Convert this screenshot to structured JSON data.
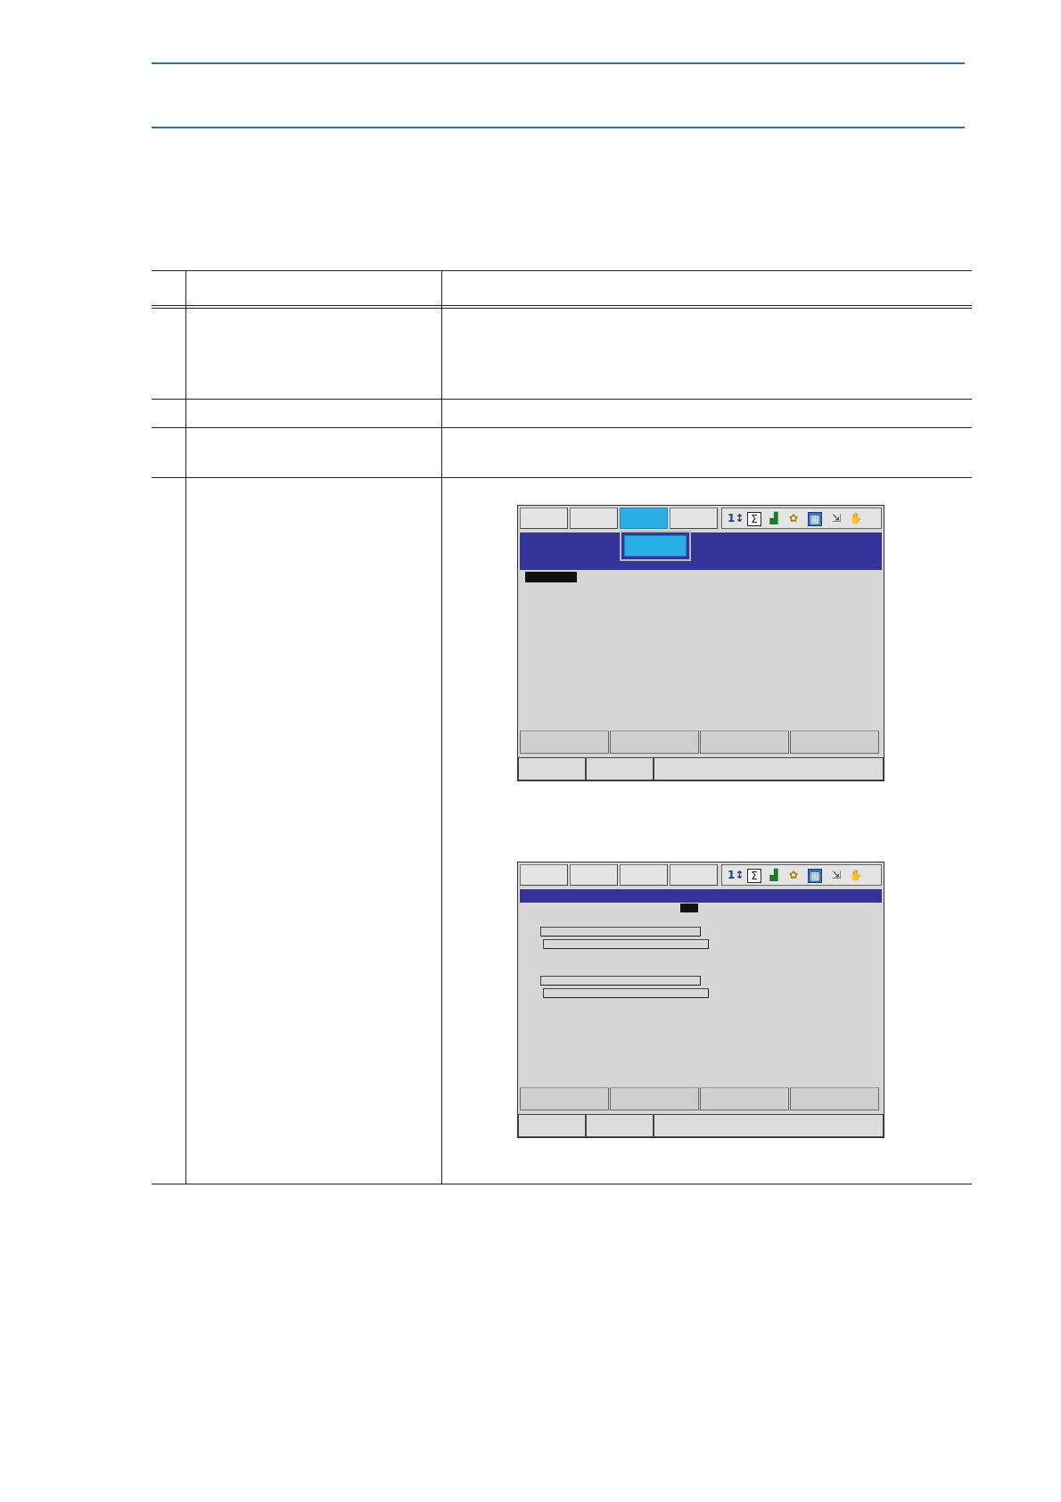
{
  "page": {
    "header_text": "",
    "intro_text": ""
  },
  "table": {
    "headers": {
      "no": "",
      "operation": "",
      "explanation": ""
    },
    "rows": [
      {
        "no": "",
        "operation": "",
        "explanation": ""
      },
      {
        "no": "",
        "operation": "",
        "explanation": ""
      },
      {
        "no": "",
        "operation": "",
        "explanation": ""
      },
      {
        "no": "",
        "operation": "",
        "explanation": ""
      }
    ]
  },
  "screen1": {
    "menu_tabs": [
      "",
      "",
      "",
      ""
    ],
    "active_tab_index": 2,
    "dropdown_item": "",
    "title": "",
    "selected_item": ""
  },
  "screen2": {
    "menu_tabs": [
      "",
      "",
      "",
      ""
    ],
    "title": ""
  },
  "status_icons": [
    "step-icon",
    "sigma-icon",
    "signal-icon",
    "tool-icon",
    "grid-icon",
    "exit-icon",
    "hand-icon"
  ],
  "colors": {
    "accent_rule": "#2a6fb0",
    "title_bar": "#35349a",
    "active_tab": "#29aee6",
    "screen_bg": "#d6d6d6"
  }
}
